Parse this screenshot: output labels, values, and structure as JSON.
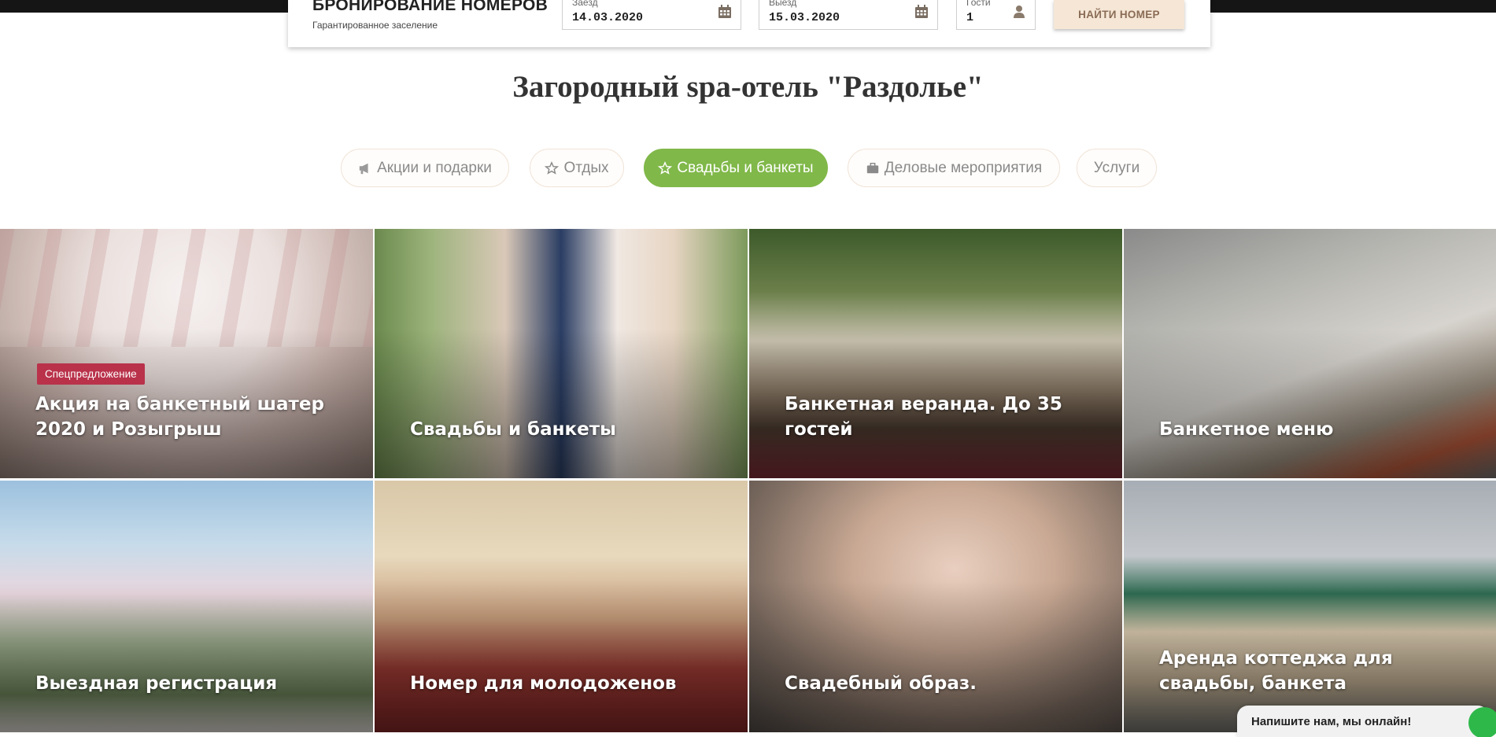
{
  "booking": {
    "title": "БРОНИРОВАНИЕ НОМЕРОВ",
    "subtitle": "Гарантированное заселение",
    "checkin_label": "Заезд",
    "checkin_value": "14.03.2020",
    "checkout_label": "Выезд",
    "checkout_value": "15.03.2020",
    "guests_label": "Гости",
    "guests_value": "1",
    "find_button": "НАЙТИ НОМЕР"
  },
  "page_title": "Загородный spa-отель \"Раздолье\"",
  "tabs": [
    {
      "label": "Акции и подарки",
      "icon": "megaphone-icon",
      "active": false
    },
    {
      "label": "Отдых",
      "icon": "star-outline-icon",
      "active": false
    },
    {
      "label": "Свадьбы и банкеты",
      "icon": "star-outline-icon",
      "active": true
    },
    {
      "label": "Деловые мероприятия",
      "icon": "briefcase-icon",
      "active": false
    },
    {
      "label": "Услуги",
      "icon": "",
      "active": false
    }
  ],
  "tiles": [
    {
      "title": "Акция на банкетный шатер 2020 и Розыгрыш",
      "badge": "Спецпредложение"
    },
    {
      "title": "Свадьбы и банкеты"
    },
    {
      "title": "Банкетная веранда. До 35 гостей"
    },
    {
      "title": "Банкетное меню"
    },
    {
      "title": "Выездная регистрация"
    },
    {
      "title": "Номер для молодоженов"
    },
    {
      "title": "Свадебный образ."
    },
    {
      "title": "Аренда коттеджа для свадьбы, банкета"
    }
  ],
  "chat": {
    "label": "Напишите нам, мы онлайн!"
  },
  "colors": {
    "accent_green": "#80b849",
    "badge_red": "#b9324a",
    "button_beige": "#f5e6d6"
  }
}
